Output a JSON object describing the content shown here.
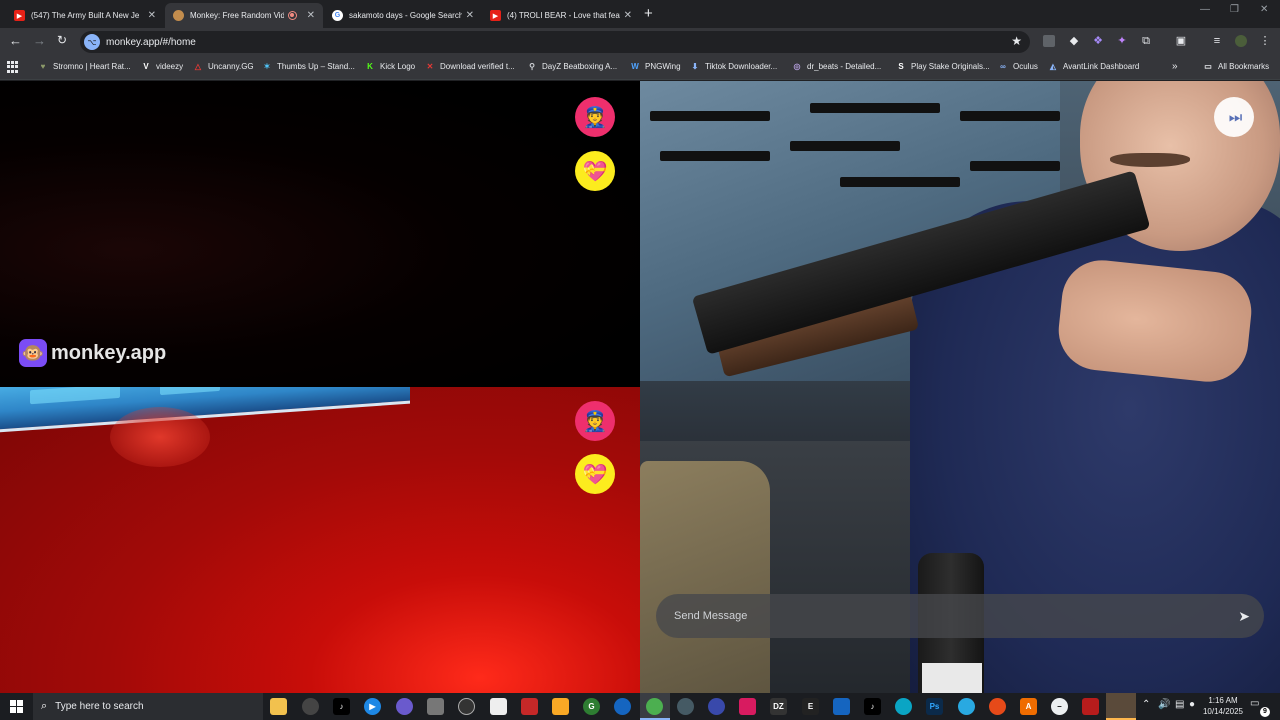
{
  "tabs": [
    {
      "title": "(547) The Army Built A New Je",
      "favicon": "youtube-icon",
      "active": false
    },
    {
      "title": "Monkey: Free Random Vide",
      "favicon": "monkey-icon",
      "active": true
    },
    {
      "title": "sakamoto days - Google Search",
      "favicon": "google-icon",
      "active": false
    },
    {
      "title": "(4) TROLI BEAR - Love that feat",
      "favicon": "youtube-icon",
      "active": false
    }
  ],
  "toolbar": {
    "url": "monkey.app/#/home"
  },
  "bookmarks": [
    {
      "label": "Stromno | Heart Rat...",
      "icon": "heart-icon"
    },
    {
      "label": "videezy",
      "icon": "v-icon"
    },
    {
      "label": "Uncanny.GG",
      "icon": "triangle-icon"
    },
    {
      "label": "Thumbs Up – Stand...",
      "icon": "star-icon"
    },
    {
      "label": "Kick Logo",
      "icon": "kick-icon"
    },
    {
      "label": "Download verified t...",
      "icon": "x-icon"
    },
    {
      "label": "DayZ Beatboxing A...",
      "icon": "pin-icon"
    },
    {
      "label": "PNGWing",
      "icon": "wing-icon"
    },
    {
      "label": "Tiktok Downloader...",
      "icon": "download-icon"
    },
    {
      "label": "dr_beats - Detailed...",
      "icon": "chart-icon"
    },
    {
      "label": "Play Stake Originals...",
      "icon": "s-icon"
    },
    {
      "label": "Oculus",
      "icon": "oculus-icon"
    },
    {
      "label": "AvantLink Dashboard",
      "icon": "avantlink-icon"
    }
  ],
  "all_bookmarks_label": "All Bookmarks",
  "brand": {
    "name": "monkey.app",
    "logo_emoji": "🐵"
  },
  "overlay": {
    "report_emoji": "👮",
    "gift_emoji": "💝",
    "skip_glyph": "⏭"
  },
  "chat": {
    "placeholder": "Send Message",
    "send_glyph": "➤"
  },
  "taskbar": {
    "search_placeholder": "Type here to search",
    "time": "1:16 AM",
    "date": "10/14/2025",
    "notification_count": "9"
  },
  "colors": {
    "report_bg": "#ee2f6d",
    "gift_bg": "#fcec1e",
    "brand_logo_bg": "#7b4cf5"
  }
}
